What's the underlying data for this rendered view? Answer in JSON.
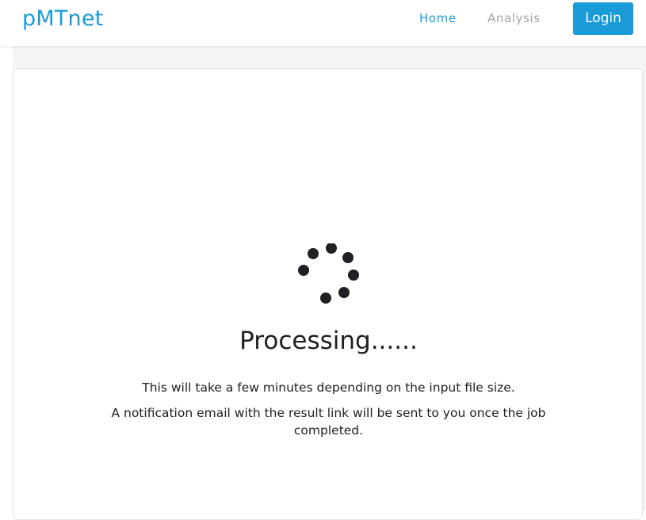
{
  "navbar": {
    "brand": "pMTnet",
    "links": [
      {
        "label": "Home",
        "active": true
      },
      {
        "label": "Analysis",
        "active": false
      }
    ],
    "login_label": "Login"
  },
  "main": {
    "title": "Processing......",
    "message_line1": "This will take a few minutes depending on the input file size.",
    "message_line2": "A notification email with the result link will be sent to you once the job completed."
  },
  "colors": {
    "accent": "#1a9ad6",
    "inactive_link": "#a3a3a3",
    "text": "#1f1f1f",
    "spinner": "#1f2024"
  },
  "icons": {
    "spinner": "loading-spinner-icon"
  }
}
